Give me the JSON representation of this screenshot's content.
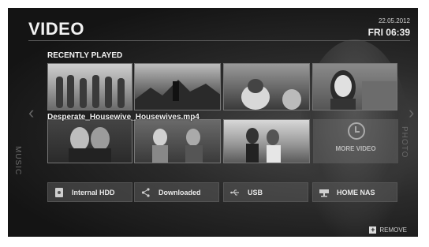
{
  "header": {
    "title": "VIDEO",
    "date": "22.05.2012",
    "time": "FRI 06:39"
  },
  "section_title": "RECENTLY PLAYED",
  "nav": {
    "left": "MUSIC",
    "right": "PHOTO"
  },
  "selected_filename": "Desperate_Housewive_Housewives.mp4",
  "more_video_label": "MORE VIDEO",
  "sources": [
    {
      "label": "Internal HDD",
      "icon": "hdd-icon"
    },
    {
      "label": "Downloaded",
      "icon": "share-icon"
    },
    {
      "label": "USB",
      "icon": "usb-icon"
    },
    {
      "label": "HOME NAS",
      "icon": "nas-icon"
    }
  ],
  "remove_label": "REMOVE"
}
